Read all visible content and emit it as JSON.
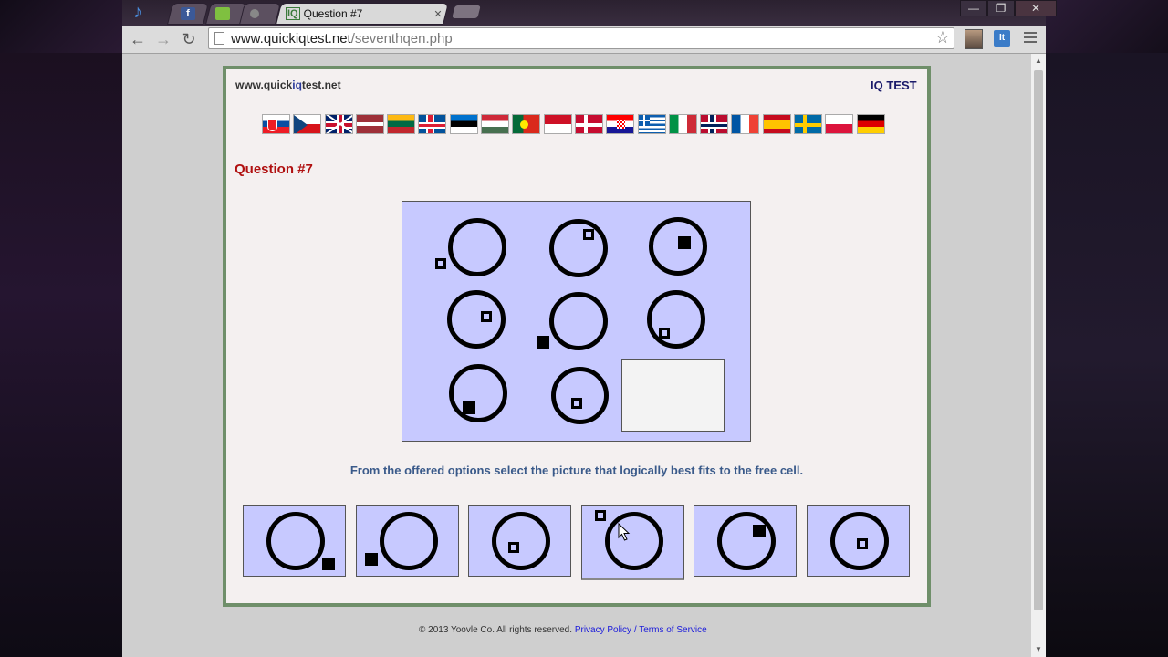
{
  "browser": {
    "active_tab_title": "Question #7",
    "tab_icon_label": "IQ",
    "facebook_tab_icon": "f",
    "url_domain": "www.quickiqtest.net",
    "url_path": "/seventhqen.php",
    "window_controls": {
      "minimize": "—",
      "restore": "❐",
      "close": "✕"
    },
    "ext_label": "It",
    "back_icon": "←",
    "forward_icon": "→",
    "reload_icon": "↻",
    "star_icon": "☆"
  },
  "header": {
    "site_link": "www.quickiqtest.net",
    "site_link_prefix": "www.quick",
    "site_link_highlight": "iq",
    "site_link_suffix": "test.net",
    "brand": "IQ TEST"
  },
  "flags": [
    "slovakia",
    "czech",
    "uk",
    "latvia",
    "lithuania",
    "iceland",
    "estonia",
    "hungary",
    "portugal",
    "indonesia",
    "denmark",
    "croatia",
    "greece",
    "italy",
    "norway",
    "france",
    "spain",
    "sweden",
    "poland",
    "germany"
  ],
  "question": {
    "title": "Question #7",
    "instructions": "From the offered options select the picture that logically best fits to the free cell."
  },
  "options_count": 6,
  "footer": {
    "copyright": "© 2013 Yoovle Co. All rights reserved.",
    "privacy": "Privacy Policy",
    "separator": " / ",
    "terms": "Terms of Service"
  }
}
